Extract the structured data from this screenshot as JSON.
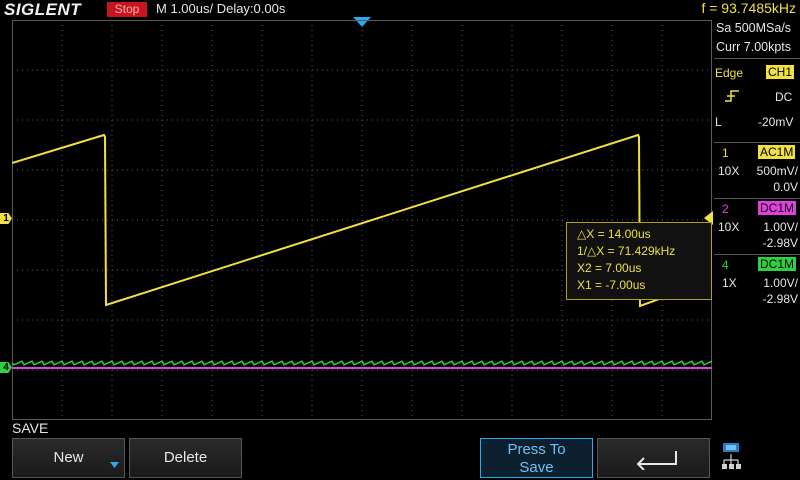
{
  "topbar": {
    "brand": "SIGLENT",
    "run_state": "Stop",
    "timebase": "M 1.00us/  Delay:0.00s",
    "frequency": "f = 93.7485kHz"
  },
  "left_markers": {
    "ch1": "1",
    "ch4": "4"
  },
  "cursor_panel": {
    "dx": "△X = 14.00us",
    "inv_dx": "1/△X = 71.429kHz",
    "x2": "X2 = 7.00us",
    "x1": "X1 = -7.00us"
  },
  "right_panel": {
    "sample_rate": "Sa 500MSa/s",
    "memory_depth": "Curr 7.00kpts",
    "trigger": {
      "type": "Edge",
      "source": "CH1",
      "coupling": "DC",
      "slope_label": "L",
      "level": "-20mV"
    },
    "channels": [
      {
        "num": "1",
        "coupling": "AC1M",
        "probe": "10X",
        "scale": "500mV/",
        "offset": "0.0V",
        "color": "#f0e040"
      },
      {
        "num": "2",
        "coupling": "DC1M",
        "probe": "10X",
        "scale": "1.00V/",
        "offset": "-2.98V",
        "color": "#e040e0"
      },
      {
        "num": "4",
        "coupling": "DC1M",
        "probe": "1X",
        "scale": "1.00V/",
        "offset": "-2.98V",
        "color": "#30d040"
      }
    ]
  },
  "menu": {
    "title": "SAVE",
    "new_label": "New",
    "delete_label": "Delete",
    "press_to_save_line1": "Press To",
    "press_to_save_line2": "Save"
  },
  "colors": {
    "ch1": "#f0e040",
    "ch2": "#e040e0",
    "ch4": "#30d040",
    "accent": "#2aa8f0",
    "stop": "#c8141e"
  },
  "icons": [
    "trigger-rising-edge-icon",
    "return-arrow-icon",
    "network-icon",
    "dropdown-arrow-icon"
  ]
}
